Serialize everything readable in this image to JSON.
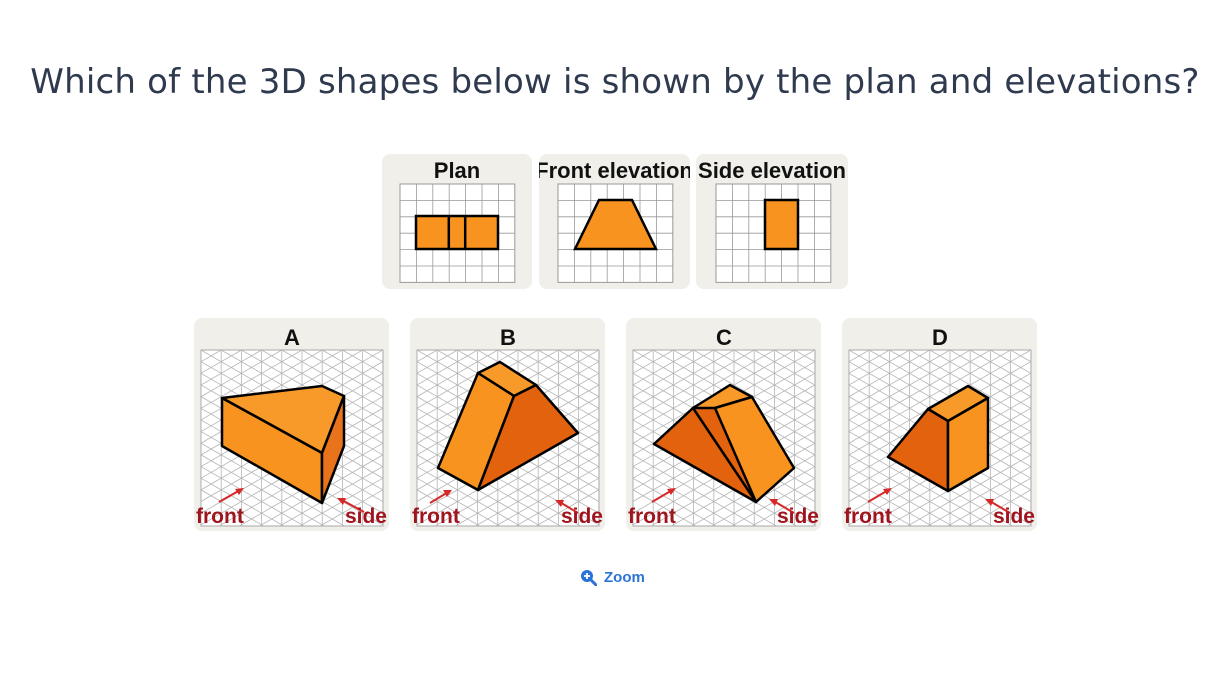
{
  "question": "Which of the 3D shapes below is shown by the plan and elevations?",
  "views": {
    "plan": "Plan",
    "front": "Front elevation",
    "side": "Side elevation"
  },
  "options": [
    {
      "letter": "A",
      "front": "front",
      "side": "side"
    },
    {
      "letter": "B",
      "front": "front",
      "side": "side"
    },
    {
      "letter": "C",
      "front": "front",
      "side": "side"
    },
    {
      "letter": "D",
      "front": "front",
      "side": "side"
    }
  ],
  "zoom": {
    "label": "Zoom",
    "icon": "zoom-in-icon"
  },
  "colors": {
    "text": "#2f3a4f",
    "panel": "#f1efe9",
    "shape_light": "#f7931e",
    "shape_dark": "#e2620d",
    "arrow": "#d62828",
    "direction_label": "#a0141e",
    "link": "#2b73d8"
  }
}
